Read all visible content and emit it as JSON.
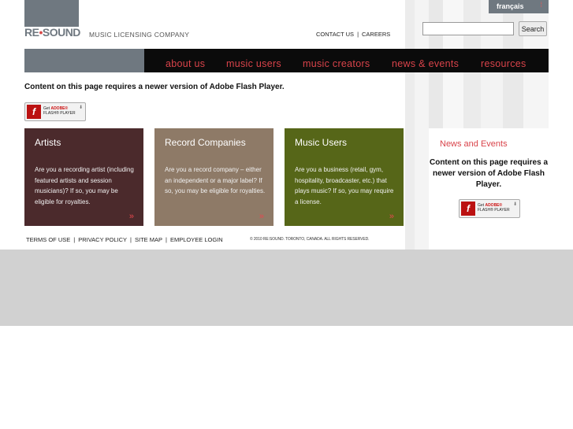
{
  "header": {
    "logo_text_left": "RE",
    "logo_text_dot": "•",
    "logo_text_right": "SOUND",
    "tagline": "MUSIC LICENSING COMPANY",
    "language_link": "français",
    "language_mark": "⁞",
    "links": [
      "CONTACT US",
      "|",
      "CAREERS"
    ]
  },
  "search": {
    "value": "",
    "button_label": "Search"
  },
  "nav": {
    "items": [
      "about us",
      "music users",
      "music creators",
      "news & events",
      "resources"
    ]
  },
  "flash": {
    "message": "Content on this page requires a newer version of Adobe Flash Player.",
    "badge_icon": "f",
    "badge_line1_prefix": "Get ",
    "badge_line1_brand": "ADOBE®",
    "badge_line2": "FLASH® PLAYER",
    "badge_arrow": "⬇"
  },
  "panels": [
    {
      "title": "Artists",
      "body": "Are you a recording artist (including featured artists and session musicians)? If so, you may be eligible for royalties.",
      "arrow": "»"
    },
    {
      "title": "Record Companies",
      "body": "Are you a record company – either an independent or a major label? If so, you may be eligible for royalties.",
      "arrow": "»"
    },
    {
      "title": "Music Users",
      "body": "Are you a business (retail, gym, hospitality, broadcaster, etc.) that plays music? If so, you may require a license.",
      "arrow": "»"
    }
  ],
  "news": {
    "title": "News and Events",
    "message": "Content on this page requires a newer version of Adobe Flash Player."
  },
  "footer": {
    "links": [
      "TERMS OF USE",
      "|",
      "PRIVACY POLICY",
      "|",
      "SITE MAP",
      "|",
      "EMPLOYEE LOGIN"
    ],
    "copyright": "© 2010 RE:SOUND. TORONTO, CANADA. ALL RIGHTS RESERVED."
  },
  "colors": {
    "nav_background": "#0b0b0b",
    "nav_text": "#d9434a",
    "logo_gray": "#6f7880",
    "artists_panel": "#4b2a2c",
    "record_panel": "#8e7a67",
    "music_users_panel": "#566618",
    "lower_band": "#d1d1d1"
  }
}
